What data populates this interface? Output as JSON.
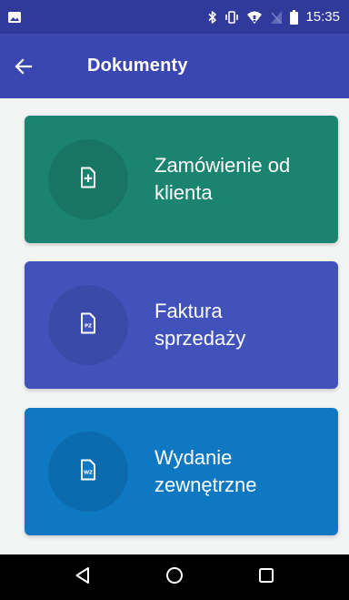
{
  "status_bar": {
    "time": "15:35",
    "icons": [
      "image-icon",
      "bluetooth-icon",
      "vibrate-icon",
      "wifi-icon",
      "no-sim-icon",
      "battery-icon"
    ]
  },
  "app_bar": {
    "title": "Dokumenty",
    "back_icon": "arrow-back-icon"
  },
  "cards": [
    {
      "line1": "Zamówienie od",
      "line2": "klienta",
      "icon": "document-plus-icon",
      "color": "#1b8471"
    },
    {
      "line1": "Faktura",
      "line2": "sprzedaży",
      "icon": "document-pz-icon",
      "icon_text": "PZ",
      "color": "#4153bb"
    },
    {
      "line1": "Wydanie",
      "line2": "zewnętrzne",
      "icon": "document-wz-icon",
      "icon_text": "WZ",
      "color": "#0e78c3"
    }
  ],
  "nav_bar": {
    "icons": [
      "nav-back-icon",
      "nav-home-icon",
      "nav-recents-icon"
    ]
  },
  "colors": {
    "status_bar": "#2f3a9a",
    "app_bar": "#3a47b2",
    "background": "#f3f4f4"
  }
}
